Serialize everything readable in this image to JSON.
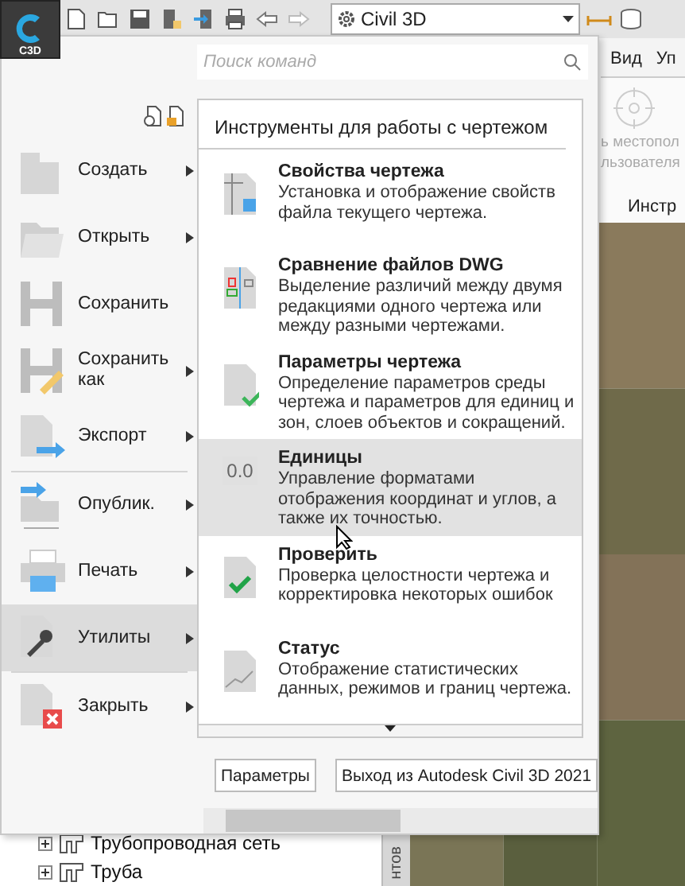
{
  "app_button": {
    "label": "C3D"
  },
  "quick_access": {
    "workspace": "Civil 3D"
  },
  "ribbon": {
    "tabs": [
      "Вид",
      "Уп"
    ],
    "panel_lines": [
      "ь местопол",
      "льзователя"
    ],
    "panel_label": "Инстр"
  },
  "search": {
    "placeholder": "Поиск команд"
  },
  "menu": {
    "items": [
      {
        "label": "Создать",
        "submenu": true,
        "selected": false
      },
      {
        "label": "Открыть",
        "submenu": true,
        "selected": false
      },
      {
        "label": "Сохранить",
        "submenu": false,
        "selected": false
      },
      {
        "label": "Сохранить как",
        "submenu": true,
        "selected": false
      },
      {
        "label": "Экспорт",
        "submenu": true,
        "selected": false
      },
      {
        "label": "Опублик.",
        "submenu": true,
        "selected": false
      },
      {
        "label": "Печать",
        "submenu": true,
        "selected": false
      },
      {
        "label": "Утилиты",
        "submenu": true,
        "selected": true
      },
      {
        "label": "Закрыть",
        "submenu": true,
        "selected": false
      }
    ]
  },
  "submenu": {
    "title": "Инструменты для работы с чертежом",
    "items": [
      {
        "title": "Свойства чертежа",
        "description": "Установка и отображение свойств файла текущего чертежа.",
        "selected": false
      },
      {
        "title": "Сравнение файлов DWG",
        "description": "Выделение различий между двумя редакциями одного чертежа или между разными чертежами.",
        "selected": false
      },
      {
        "title": "Параметры чертежа",
        "description": "Определение параметров среды чертежа и параметров для единиц и зон, слоев объектов и сокращений.",
        "selected": false
      },
      {
        "title": "Единицы",
        "description": "Управление форматами отображения координат и углов, а также их точностью.",
        "selected": true,
        "icon_text": "0.0"
      },
      {
        "title": "Проверить",
        "description": "Проверка целостности чертежа и корректировка некоторых ошибок",
        "selected": false
      },
      {
        "title": "Статус",
        "description": "Отображение статистических данных, режимов и границ чертежа.",
        "selected": false
      }
    ]
  },
  "buttons": [
    "Параметры",
    "Выход из Autodesk Civil 3D 2021"
  ],
  "tree": {
    "items": [
      {
        "label": "Трубопроводная сеть",
        "expanded": false
      },
      {
        "label": "Труба",
        "expanded": false
      }
    ]
  },
  "side_tab": "нтов"
}
